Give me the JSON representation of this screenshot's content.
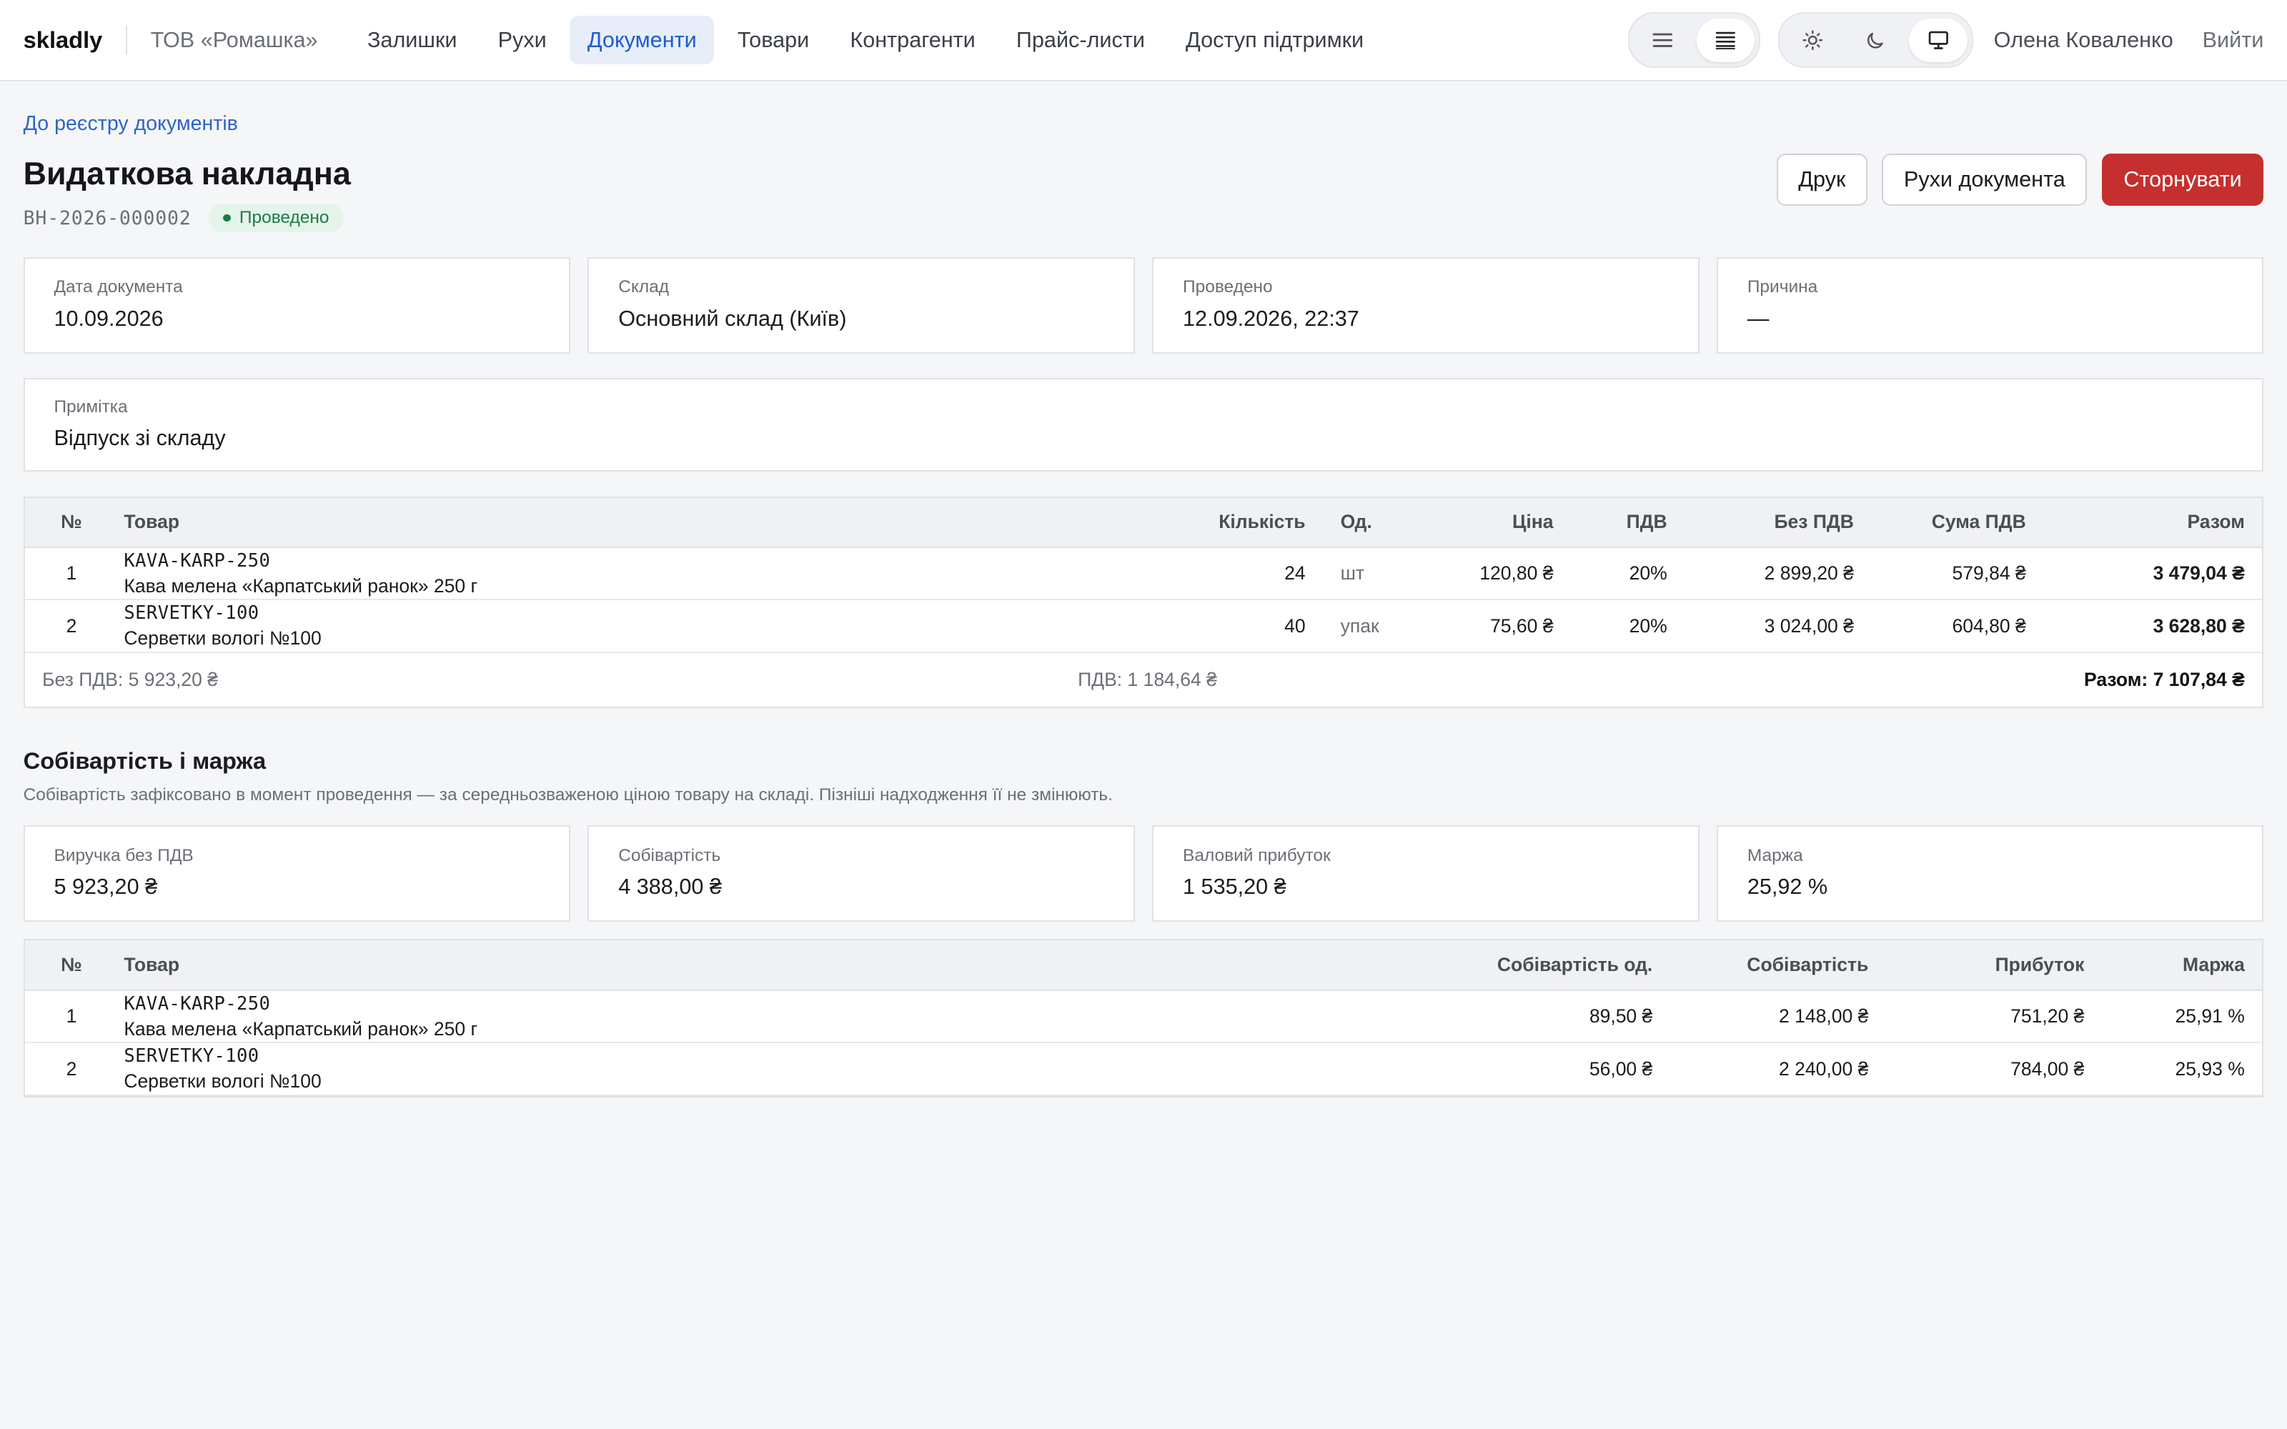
{
  "app": {
    "brand": "skladly",
    "company": "ТОВ «Ромашка»",
    "nav": [
      "Залишки",
      "Рухи",
      "Документи",
      "Товари",
      "Контрагенти",
      "Прайс-листи",
      "Доступ підтримки"
    ],
    "active_nav": "Документи",
    "user": "Олена Коваленко",
    "logout": "Вийти"
  },
  "page": {
    "back_link": "До реєстру документів",
    "title": "Видаткова накладна",
    "number": "ВН-2026-000002",
    "status": "Проведено",
    "status_color": "#1d7a45",
    "actions": {
      "print": "Друк",
      "movements": "Рухи документа",
      "reverse": "Сторнувати"
    },
    "accent_danger": "#c62f2f"
  },
  "info_cards": [
    {
      "label": "Дата документа",
      "value": "10.09.2026"
    },
    {
      "label": "Склад",
      "value": "Основний склад (Київ)"
    },
    {
      "label": "Проведено",
      "value": "12.09.2026, 22:37"
    },
    {
      "label": "Причина",
      "value": "—"
    }
  ],
  "note": {
    "label": "Примітка",
    "value": "Відпуск зі складу"
  },
  "items_table": {
    "headers": [
      "№",
      "Товар",
      "Кількість",
      "Од.",
      "Ціна",
      "ПДВ",
      "Без ПДВ",
      "Сума ПДВ",
      "Разом"
    ],
    "rows": [
      {
        "n": "1",
        "sku": "KAVA-KARP-250",
        "name": "Кава мелена «Карпатський ранок» 250 г",
        "qty": "24",
        "unit": "шт",
        "price": "120,80 ₴",
        "vat": "20%",
        "net": "2 899,20 ₴",
        "vat_sum": "579,84 ₴",
        "total": "3 479,04 ₴"
      },
      {
        "n": "2",
        "sku": "SERVETKY-100",
        "name": "Серветки вологі №100",
        "qty": "40",
        "unit": "упак",
        "price": "75,60 ₴",
        "vat": "20%",
        "net": "3 024,00 ₴",
        "vat_sum": "604,80 ₴",
        "total": "3 628,80 ₴"
      }
    ],
    "totals": {
      "net": "Без ПДВ: 5 923,20 ₴",
      "vat": "ПДВ: 1 184,64 ₴",
      "total": "Разом: 7 107,84 ₴"
    }
  },
  "cost_section": {
    "title": "Собівартість і маржа",
    "description": "Собівартість зафіксовано в момент проведення — за середньозваженою ціною товару на складі. Пізніші надходження її не змінюють.",
    "cards": [
      {
        "label": "Виручка без ПДВ",
        "value": "5 923,20 ₴"
      },
      {
        "label": "Собівартість",
        "value": "4 388,00 ₴"
      },
      {
        "label": "Валовий прибуток",
        "value": "1 535,20 ₴"
      },
      {
        "label": "Маржа",
        "value": "25,92 %"
      }
    ],
    "table": {
      "headers": [
        "№",
        "Товар",
        "Собівартість од.",
        "Собівартість",
        "Прибуток",
        "Маржа"
      ],
      "rows": [
        {
          "n": "1",
          "sku": "KAVA-KARP-250",
          "name": "Кава мелена «Карпатський ранок» 250 г",
          "unit_cost": "89,50 ₴",
          "cost": "2 148,00 ₴",
          "profit": "751,20 ₴",
          "margin": "25,91 %"
        },
        {
          "n": "2",
          "sku": "SERVETKY-100",
          "name": "Серветки вологі №100",
          "unit_cost": "56,00 ₴",
          "cost": "2 240,00 ₴",
          "profit": "784,00 ₴",
          "margin": "25,93 %"
        }
      ]
    }
  },
  "icons": [
    "list-compact-icon",
    "list-dense-icon",
    "sun-icon",
    "moon-icon",
    "monitor-icon"
  ]
}
